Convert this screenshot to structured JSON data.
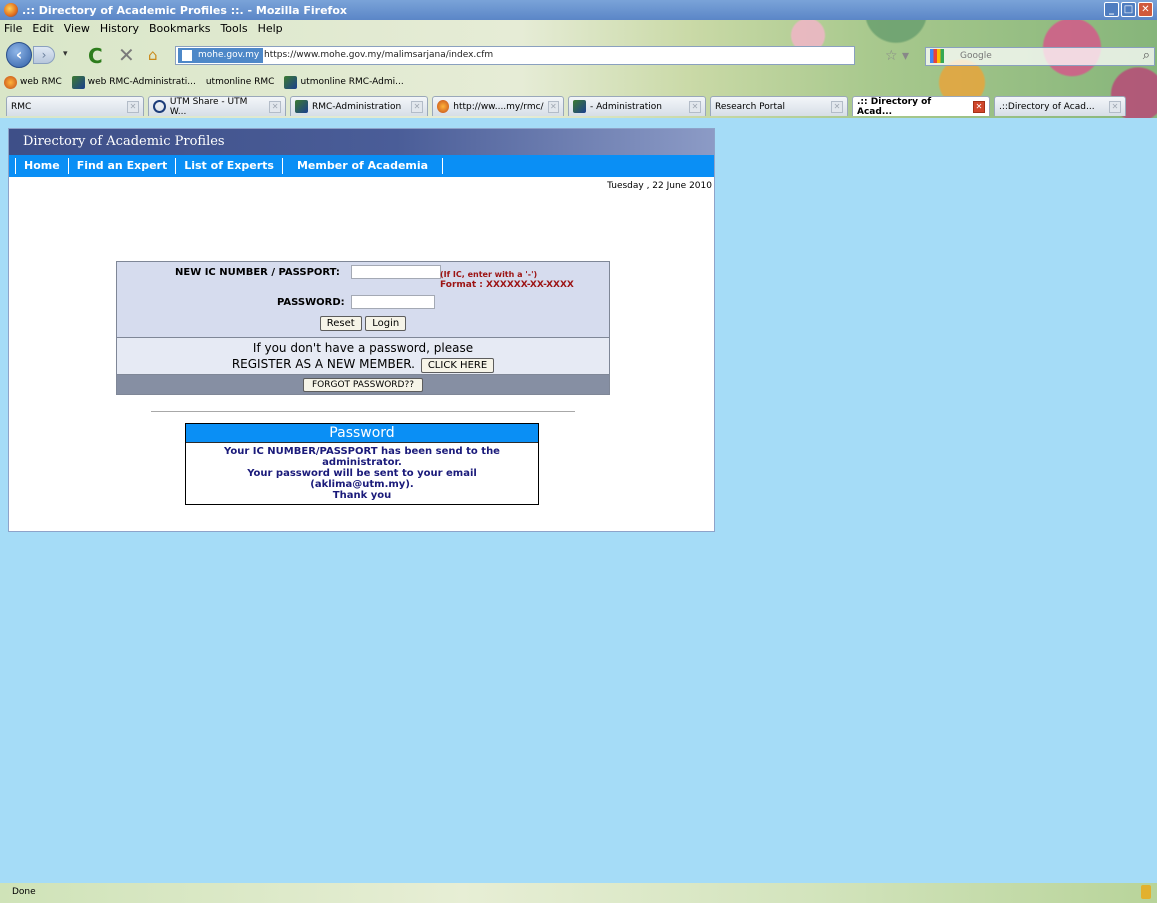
{
  "browser": {
    "window_title": ".:: Directory of Academic Profiles ::. - Mozilla Firefox",
    "menu": [
      "File",
      "Edit",
      "View",
      "History",
      "Bookmarks",
      "Tools",
      "Help"
    ],
    "site_identity": "mohe.gov.my",
    "url": "https://www.mohe.gov.my/malimsarjana/index.cfm",
    "search_placeholder": "Google",
    "bookmarks": [
      {
        "label": "web RMC",
        "icon": "rmc-icon"
      },
      {
        "label": "web RMC-Administrati...",
        "icon": "admin-icon"
      },
      {
        "label": "utmonline RMC",
        "icon": "page-icon"
      },
      {
        "label": "utmonline RMC-Admi...",
        "icon": "admin-icon"
      }
    ],
    "tabs": [
      {
        "label": "RMC",
        "active": false
      },
      {
        "label": "UTM Share - UTM W...",
        "active": false
      },
      {
        "label": "RMC-Administration",
        "active": false
      },
      {
        "label": "http://ww....my/rmc/",
        "active": false
      },
      {
        "label": "- Administration",
        "active": false
      },
      {
        "label": "Research Portal",
        "active": false
      },
      {
        "label": ".:: Directory of Acad...",
        "active": true
      },
      {
        "label": ".::Directory of Acad...",
        "active": false
      }
    ],
    "status_text": "Done"
  },
  "site": {
    "header_title": "Directory of Academic Profiles",
    "nav": [
      "Home",
      "Find an Expert",
      "List of Experts",
      "Member of Academia"
    ],
    "date": "Tuesday , 22 June 2010"
  },
  "login": {
    "ic_label": "NEW IC NUMBER / PASSPORT:",
    "ic_value": "",
    "hint_line1": "(If IC, enter with a '-')",
    "hint_line2": "Format : XXXXXX-XX-XXXX",
    "password_label": "PASSWORD:",
    "password_value": "",
    "reset_label": "Reset",
    "login_label": "Login",
    "register_line1": "If you don't have a password, please",
    "register_line2": "REGISTER AS A NEW MEMBER.",
    "click_here_label": "CLICK HERE",
    "forgot_label": "FORGOT PASSWORD??"
  },
  "notice": {
    "title": "Password",
    "line1": "Your IC NUMBER/PASSPORT has been send to the",
    "line2": "administrator.",
    "line3": "Your password will be sent to your email",
    "line4": "(aklima@utm.my).",
    "line5": "Thank you"
  }
}
